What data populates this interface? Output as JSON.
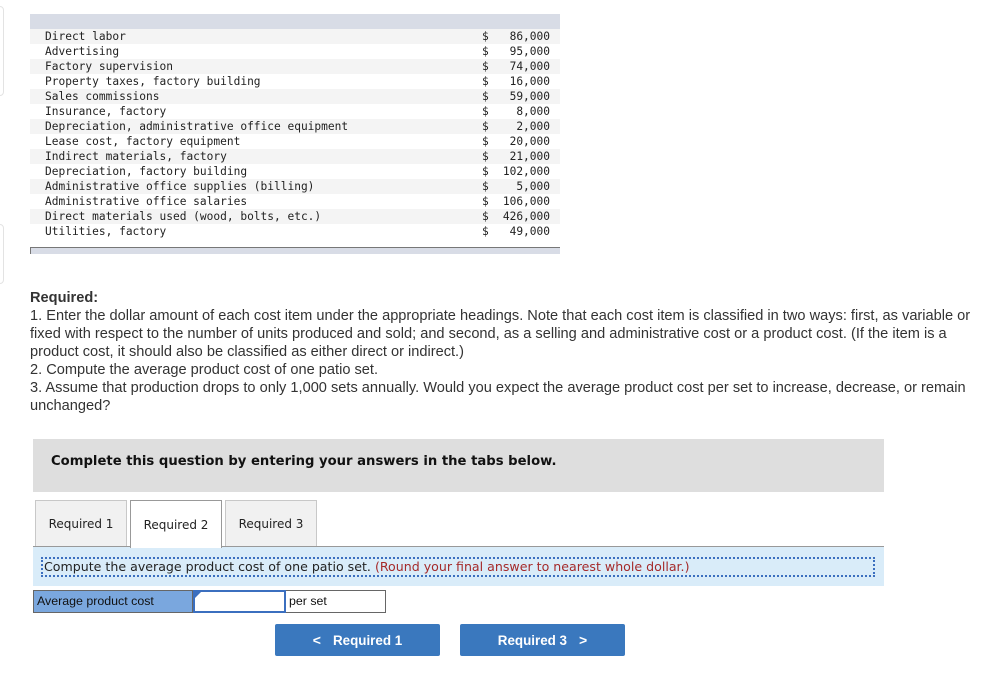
{
  "cost_table": {
    "rows": [
      {
        "label": "Direct labor",
        "currency": "$",
        "amount": "86,000"
      },
      {
        "label": "Advertising",
        "currency": "$",
        "amount": "95,000"
      },
      {
        "label": "Factory supervision",
        "currency": "$",
        "amount": "74,000"
      },
      {
        "label": "Property taxes, factory building",
        "currency": "$",
        "amount": "16,000"
      },
      {
        "label": "Sales commissions",
        "currency": "$",
        "amount": "59,000"
      },
      {
        "label": "Insurance, factory",
        "currency": "$",
        "amount": "8,000"
      },
      {
        "label": "Depreciation, administrative office equipment",
        "currency": "$",
        "amount": "2,000"
      },
      {
        "label": "Lease cost, factory equipment",
        "currency": "$",
        "amount": "20,000"
      },
      {
        "label": "Indirect materials, factory",
        "currency": "$",
        "amount": "21,000"
      },
      {
        "label": "Depreciation, factory building",
        "currency": "$",
        "amount": "102,000"
      },
      {
        "label": "Administrative office supplies (billing)",
        "currency": "$",
        "amount": "5,000"
      },
      {
        "label": "Administrative office salaries",
        "currency": "$",
        "amount": "106,000"
      },
      {
        "label": "Direct materials used (wood, bolts, etc.)",
        "currency": "$",
        "amount": "426,000"
      },
      {
        "label": "Utilities, factory",
        "currency": "$",
        "amount": "49,000"
      }
    ]
  },
  "required": {
    "title": "Required:",
    "items": [
      "1. Enter the dollar amount of each cost item under the appropriate headings. Note that each cost item is classified in two ways: first, as variable or fixed with respect to the number of units produced and sold; and second, as a selling and administrative cost or a product cost. (If the item is a product cost, it should also be classified as either direct or indirect.)",
      "2. Compute the average product cost of one patio set.",
      "3. Assume that production drops to only 1,000 sets annually. Would you expect the average product cost per set to increase, decrease, or remain unchanged?"
    ]
  },
  "instructions": "Complete this question by entering your answers in the tabs below.",
  "tabs": [
    {
      "label": "Required 1",
      "active": false
    },
    {
      "label": "Required 2",
      "active": true
    },
    {
      "label": "Required 3",
      "active": false
    }
  ],
  "panel": {
    "prompt": "Compute the average product cost of one patio set.",
    "hint": "(Round your final answer to nearest whole dollar.)"
  },
  "answer": {
    "label": "Average product cost",
    "value": "",
    "unit": "per set"
  },
  "nav": {
    "prev_label": "Required 1",
    "prev_icon": "chevron-left-icon",
    "next_label": "Required 3",
    "next_icon": "chevron-right-icon"
  },
  "colors": {
    "accent": "#3a78be",
    "label_cell": "#7aa7de",
    "panel_bg": "#d9ecf9",
    "hint": "#a52a2a"
  }
}
